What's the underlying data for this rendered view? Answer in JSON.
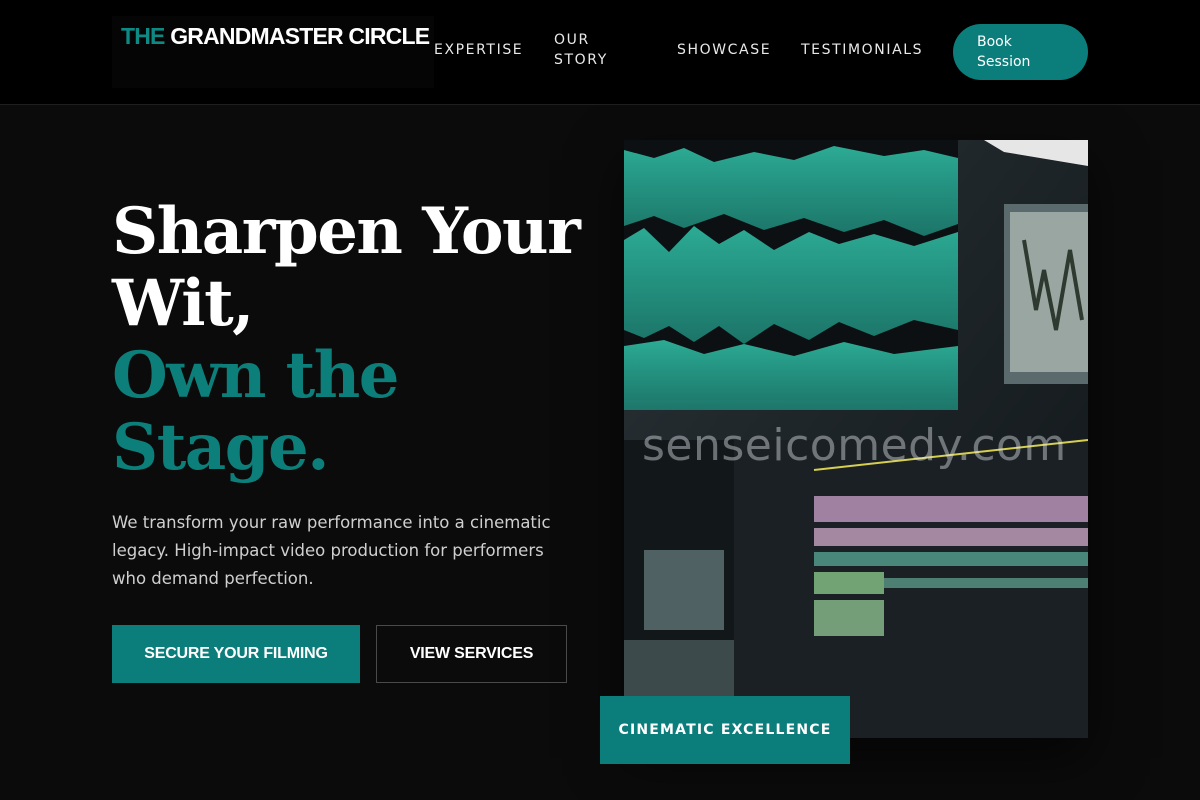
{
  "header": {
    "logo": {
      "accent": "THE",
      "rest": " GRANDMASTER CIRCLE"
    },
    "nav": [
      "EXPERTISE",
      "OUR STORY",
      "SHOWCASE",
      "TESTIMONIALS"
    ],
    "cta": "Book Session"
  },
  "hero": {
    "title_lines": [
      "Sharpen Your",
      "Wit,",
      "Own the",
      "Stage."
    ],
    "subtitle": "We transform your raw performance into a cinematic legacy. High-impact video production for performers who demand perfection.",
    "primary_button": "SECURE YOUR FILMING",
    "secondary_button": "VIEW SERVICES"
  },
  "media": {
    "watermark": "senseicomedy.com",
    "badge": "CINEMATIC EXCELLENCE"
  },
  "colors": {
    "accent": "#0b7e7b",
    "background": "#0b0b0b",
    "header": "#000000"
  }
}
